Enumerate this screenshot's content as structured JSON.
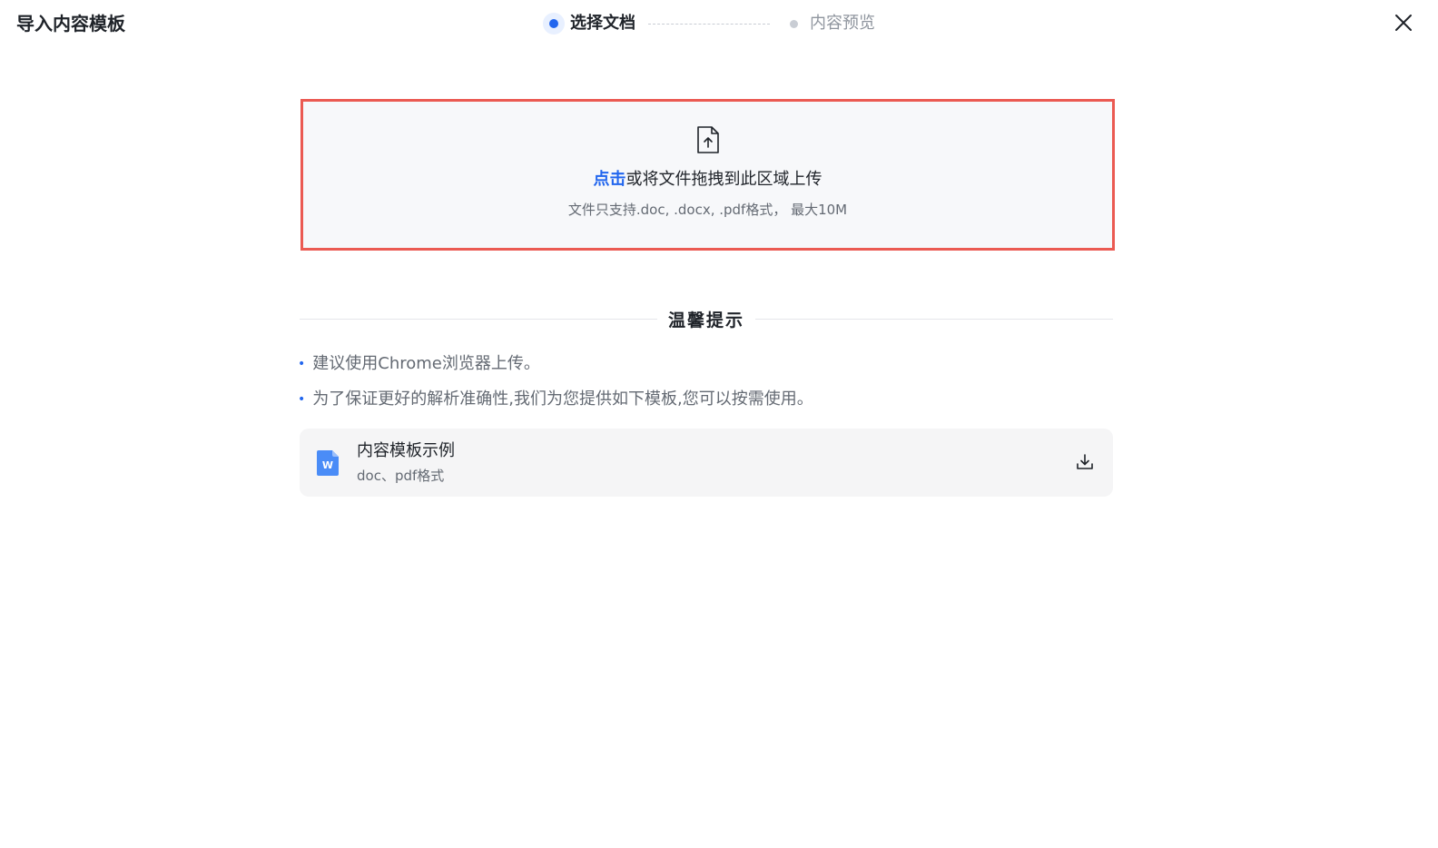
{
  "header": {
    "title": "导入内容模板",
    "steps": [
      {
        "label": "选择文档",
        "state": "active"
      },
      {
        "label": "内容预览",
        "state": "pending"
      }
    ]
  },
  "upload": {
    "link_text": "点击",
    "main_text": "或将文件拖拽到此区域上传",
    "hint": "文件只支持.doc, .docx, .pdf格式， 最大10M"
  },
  "tips": {
    "title": "温馨提示",
    "items": [
      "建议使用Chrome浏览器上传。",
      "为了保证更好的解析准确性,我们为您提供如下模板,您可以按需使用。"
    ],
    "bullet": "•"
  },
  "template": {
    "icon_letter": "W",
    "name": "内容模板示例",
    "format": "doc、pdf格式"
  },
  "colors": {
    "accent": "#2266ee",
    "upload_border": "#eb5a52",
    "word_icon": "#4a8cf7"
  }
}
